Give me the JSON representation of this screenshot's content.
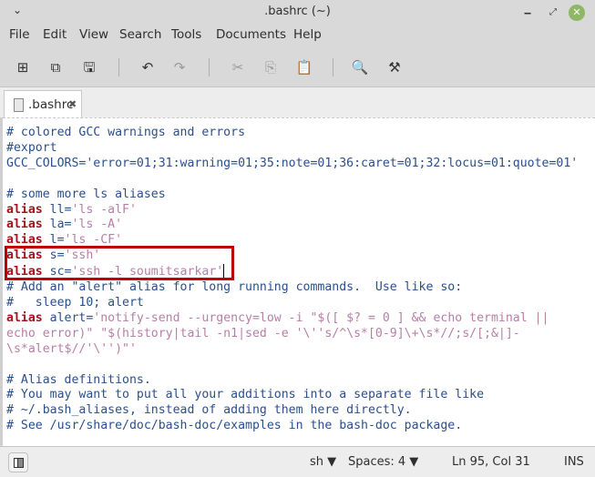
{
  "window": {
    "title": ".bashrc (~)",
    "menu_chevron": "⌄",
    "minimize": "‒",
    "maximize": "⤢",
    "close": "✕"
  },
  "menu": [
    "File",
    "Edit",
    "View",
    "Search",
    "Tools",
    "Documents",
    "Help"
  ],
  "toolbar": {
    "new": "⊞",
    "open": "⧉",
    "save": "🖫",
    "undo": "↶",
    "redo": "↷",
    "cut": "✂",
    "copy": "⎘",
    "paste": "📋",
    "find": "🔍",
    "replace": "⚒"
  },
  "tab": {
    "name": ".bashrc",
    "close": "✖"
  },
  "editor": {
    "lines": [
      {
        "type": "comment",
        "text": "# colored GCC warnings and errors"
      },
      {
        "type": "comment",
        "text": "#export"
      },
      {
        "type": "comment",
        "text": "GCC_COLORS='error=01;31:warning=01;35:note=01;36:caret=01;32:locus=01:quote=01'"
      },
      {
        "type": "blank",
        "text": ""
      },
      {
        "type": "comment",
        "text": "# some more ls aliases"
      },
      {
        "type": "alias",
        "kw": "alias",
        "name": " ll=",
        "value": "'ls -alF'"
      },
      {
        "type": "alias",
        "kw": "alias",
        "name": " la=",
        "value": "'ls -A'"
      },
      {
        "type": "alias",
        "kw": "alias",
        "name": " l=",
        "value": "'ls -CF'"
      },
      {
        "type": "alias",
        "kw": "alias",
        "name": " s=",
        "value": "'ssh'"
      },
      {
        "type": "alias",
        "kw": "alias",
        "name": " sc=",
        "value": "'ssh -l soumitsarkar'",
        "caret": true
      },
      {
        "type": "comment",
        "text": "# Add an \"alert\" alias for long running commands.  Use like so:"
      },
      {
        "type": "comment",
        "text": "#   sleep 10; alert"
      },
      {
        "type": "alias",
        "kw": "alias",
        "name": " alert=",
        "value": "'notify-send --urgency=low -i \"$([ $? = 0 ] && echo terminal ||"
      },
      {
        "type": "string",
        "text": "echo error)\" \"$(history|tail -n1|sed -e '\\''s/^\\s*[0-9]\\+\\s*//;s/[;&|]-"
      },
      {
        "type": "string",
        "text": "\\s*alert$//'\\'')\"'"
      },
      {
        "type": "blank",
        "text": ""
      },
      {
        "type": "comment",
        "text": "# Alias definitions."
      },
      {
        "type": "comment",
        "text": "# You may want to put all your additions into a separate file like"
      },
      {
        "type": "comment",
        "text": "# ~/.bash_aliases, instead of adding them here directly."
      },
      {
        "type": "comment",
        "text": "# See /usr/share/doc/bash-doc/examples in the bash-doc package."
      }
    ]
  },
  "statusbar": {
    "language": "sh ▼",
    "spaces": "Spaces: 4 ▼",
    "position": "Ln 95, Col 31",
    "mode": "INS"
  }
}
